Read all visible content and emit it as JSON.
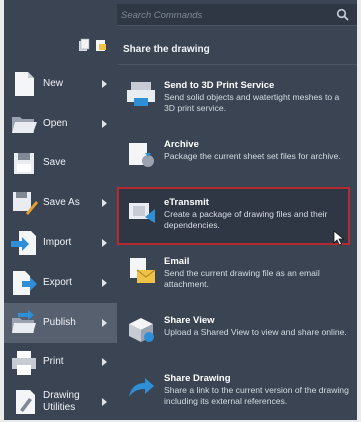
{
  "search": {
    "placeholder": "Search Commands"
  },
  "panel": {
    "title": "Share the drawing"
  },
  "menu": [
    {
      "label": "New",
      "has_submenu": true,
      "icon": "new-file-icon"
    },
    {
      "label": "Open",
      "has_submenu": true,
      "icon": "open-folder-icon"
    },
    {
      "label": "Save",
      "has_submenu": false,
      "icon": "save-icon"
    },
    {
      "label": "Save As",
      "has_submenu": true,
      "icon": "save-as-icon"
    },
    {
      "label": "Import",
      "has_submenu": true,
      "icon": "import-icon"
    },
    {
      "label": "Export",
      "has_submenu": true,
      "icon": "export-icon"
    },
    {
      "label": "Publish",
      "has_submenu": true,
      "icon": "publish-icon",
      "active": true
    },
    {
      "label": "Print",
      "has_submenu": true,
      "icon": "print-icon"
    },
    {
      "label": "Drawing Utilities",
      "has_submenu": true,
      "icon": "drawing-utilities-icon"
    }
  ],
  "items": [
    {
      "title": "Send to 3D Print Service",
      "desc": "Send solid objects and watertight meshes to a 3D print service.",
      "icon": "3d-print-icon"
    },
    {
      "title": "Archive",
      "desc": "Package the current sheet set files for archive.",
      "icon": "archive-icon"
    },
    {
      "title": "eTransmit",
      "desc": "Create a package of drawing files and their dependencies.",
      "icon": "etransmit-icon",
      "selected": true
    },
    {
      "title": "Email",
      "desc": "Send the current drawing file as an email attachment.",
      "icon": "email-icon"
    },
    {
      "title": "Share View",
      "desc": "Upload a Shared View to view and share online.",
      "icon": "share-view-icon"
    },
    {
      "title": "Share Drawing",
      "desc": "Share a link to the current version of the drawing including its external references.",
      "icon": "share-drawing-icon"
    }
  ],
  "colors": {
    "panel_bg": "#3a4453",
    "highlight_border": "#b52a30",
    "active_menu": "#56606f"
  }
}
